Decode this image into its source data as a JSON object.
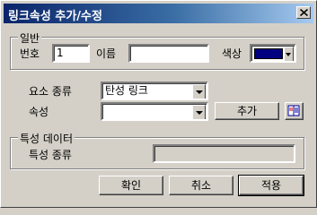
{
  "window": {
    "title": "링크속성 추가/수정"
  },
  "general": {
    "legend": "일반",
    "number_label": "번호",
    "number_value": "1",
    "name_label": "이름",
    "name_value": "",
    "color_label": "색상",
    "color_value": "#000080"
  },
  "element": {
    "type_label": "요소 종류",
    "type_value": "탄성 링크",
    "attr_label": "속성",
    "attr_value": "",
    "add_label": "추가"
  },
  "props": {
    "legend": "특성 데이터",
    "kind_label": "특성 종류",
    "kind_value": ""
  },
  "footer": {
    "ok_label": "확인",
    "cancel_label": "취소",
    "apply_label": "적용"
  }
}
